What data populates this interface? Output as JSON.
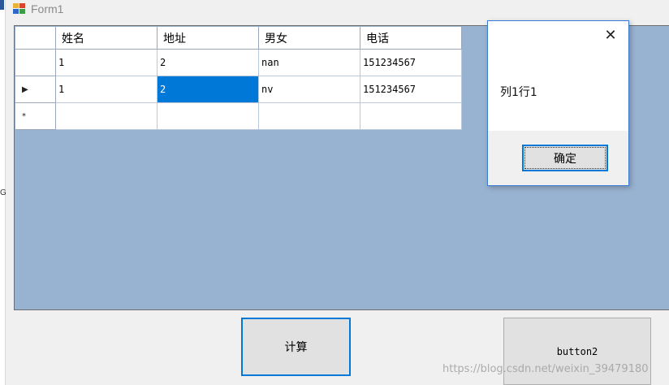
{
  "window": {
    "title": "Form1"
  },
  "grid": {
    "columns": [
      "姓名",
      "地址",
      "男女",
      "电话"
    ],
    "rows": [
      {
        "indicator": "",
        "cells": [
          "1",
          "2",
          "nan",
          "151234567"
        ]
      },
      {
        "indicator": "▶",
        "cells": [
          "1",
          "2",
          "nv",
          "151234567"
        ],
        "selected_col": 1
      },
      {
        "indicator": "*",
        "cells": [
          "",
          "",
          "",
          ""
        ]
      }
    ]
  },
  "dialog": {
    "message": "列1行1",
    "ok_label": "确定",
    "close_glyph": "✕"
  },
  "buttons": {
    "calc_label": "计算",
    "button2_label": "button2"
  },
  "left_edge": {
    "letter": "G"
  },
  "watermark": "https://blog.csdn.net/weixin_39479180",
  "colors": {
    "grid_background": "#98b2d1",
    "selection": "#0078d7",
    "focus_border": "#0078d7"
  }
}
